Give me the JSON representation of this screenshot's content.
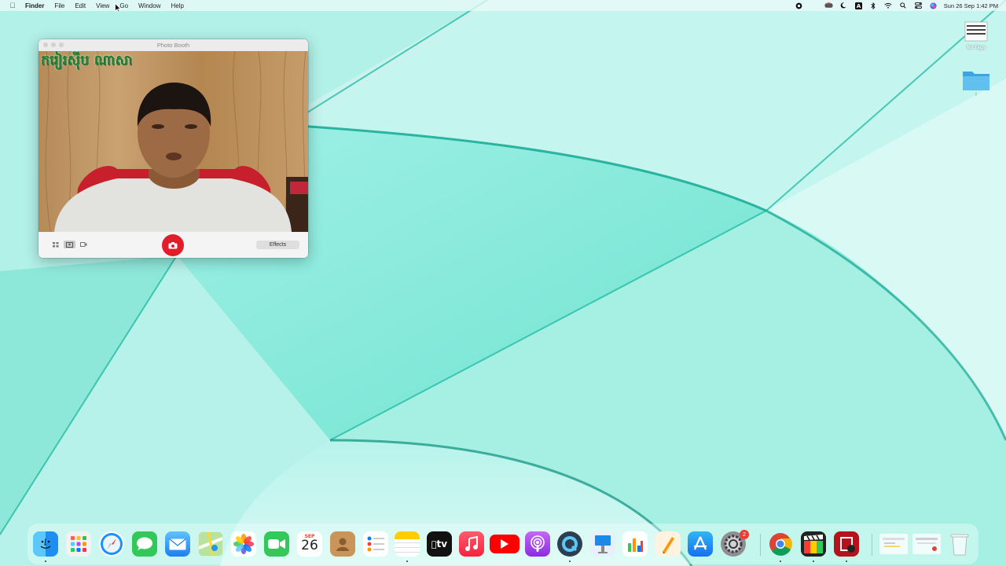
{
  "menubar": {
    "app_name": "Finder",
    "items": [
      "File",
      "Edit",
      "View",
      "Go",
      "Window",
      "Help"
    ],
    "clock": "Sun 26 Sep  1:42 PM"
  },
  "photo_booth": {
    "title": "Photo Booth",
    "overlay_text": "ករៀរស៊ីប ណាសា",
    "effects_label": "Effects"
  },
  "desktop": {
    "tag_label": "No Tags",
    "folder_label": "I"
  },
  "dock": {
    "calendar_month": "SEP",
    "calendar_day": "26",
    "tv_label": "tv",
    "settings_badge": "2"
  }
}
